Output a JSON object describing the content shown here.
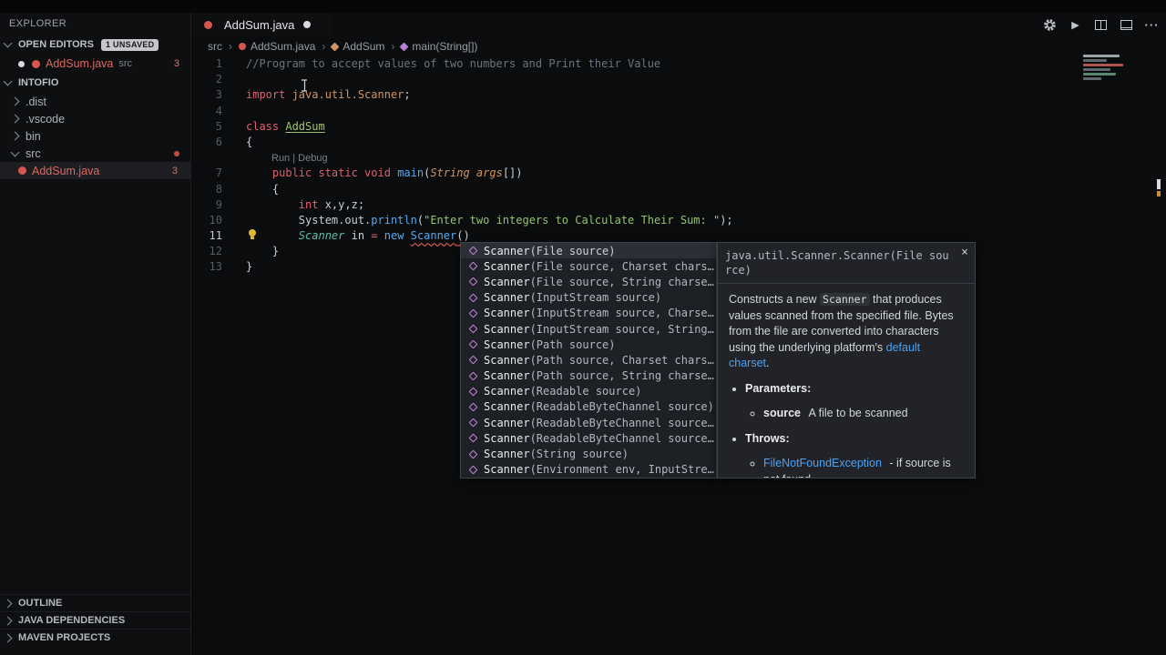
{
  "icons": {
    "close": "×",
    "run": "▶",
    "more": "···",
    "breadcrumb_separator": "›"
  },
  "window": {
    "tab": {
      "label": "AddSum.java"
    }
  },
  "sidebar": {
    "title": "EXPLORER",
    "open_editors": {
      "header": "OPEN EDITORS",
      "badge": "1 UNSAVED",
      "items": [
        {
          "label": "AddSum.java",
          "detail": "src",
          "problems": "3"
        }
      ]
    },
    "workspace": {
      "header": "INTOFIO",
      "tree": [
        {
          "label": ".dist",
          "type": "folder",
          "expanded": false
        },
        {
          "label": ".vscode",
          "type": "folder",
          "expanded": false
        },
        {
          "label": "bin",
          "type": "folder",
          "expanded": false
        },
        {
          "label": "src",
          "type": "folder",
          "expanded": true,
          "modified": true
        },
        {
          "label": "AddSum.java",
          "type": "file",
          "error": true,
          "problems": "3",
          "selected": true
        }
      ]
    },
    "sections": [
      {
        "label": "OUTLINE"
      },
      {
        "label": "JAVA DEPENDENCIES"
      },
      {
        "label": "MAVEN PROJECTS"
      }
    ]
  },
  "breadcrumb": {
    "items": [
      {
        "label": "src",
        "icon": "none"
      },
      {
        "label": "AddSum.java",
        "icon": "file"
      },
      {
        "label": "AddSum",
        "icon": "class"
      },
      {
        "label": "main(String[])",
        "icon": "method"
      }
    ]
  },
  "editor": {
    "codelens": "Run | Debug",
    "lines": [
      {
        "num": "1",
        "tokens": [
          {
            "c": "com",
            "t": "//Program to accept values of two numbers and Print their Value"
          }
        ]
      },
      {
        "num": "2",
        "tokens": []
      },
      {
        "num": "3",
        "tokens": [
          {
            "c": "kw",
            "t": "import "
          },
          {
            "c": "ns",
            "t": "java.util.Scanner"
          },
          {
            "c": "pln",
            "t": ";"
          }
        ]
      },
      {
        "num": "4",
        "tokens": []
      },
      {
        "num": "5",
        "tokens": [
          {
            "c": "kw",
            "t": "class "
          },
          {
            "c": "cls",
            "t": "AddSum"
          }
        ]
      },
      {
        "num": "6",
        "tokens": [
          {
            "c": "pln",
            "t": "{"
          }
        ]
      },
      {
        "num": "",
        "codelens": true
      },
      {
        "num": "7",
        "tokens": [
          {
            "c": "pln",
            "t": "    "
          },
          {
            "c": "kw",
            "t": "public static void "
          },
          {
            "c": "fn",
            "t": "main"
          },
          {
            "c": "pln",
            "t": "("
          },
          {
            "c": "typ",
            "t": "String args"
          },
          {
            "c": "pln",
            "t": "[])"
          }
        ]
      },
      {
        "num": "8",
        "tokens": [
          {
            "c": "pln",
            "t": "    {"
          }
        ]
      },
      {
        "num": "9",
        "tokens": [
          {
            "c": "pln",
            "t": "        "
          },
          {
            "c": "kw",
            "t": "int"
          },
          {
            "c": "pln",
            "t": " x,y,z;"
          }
        ]
      },
      {
        "num": "10",
        "tokens": [
          {
            "c": "pln",
            "t": "        System.out."
          },
          {
            "c": "fn",
            "t": "println"
          },
          {
            "c": "pln",
            "t": "("
          },
          {
            "c": "str",
            "t": "\"Enter two integers to Calculate Their Sum: \""
          },
          {
            "c": "pln",
            "t": ");"
          }
        ]
      },
      {
        "num": "11",
        "active": true,
        "lightbulb": true,
        "tokens": [
          {
            "c": "pln",
            "t": "        "
          },
          {
            "c": "sc",
            "t": "Scanner"
          },
          {
            "c": "pln",
            "t": " in "
          },
          {
            "c": "kw",
            "t": "="
          },
          {
            "c": "pln",
            "t": " "
          },
          {
            "c": "new",
            "t": "new"
          },
          {
            "c": "pln",
            "t": " "
          },
          {
            "c": "errfn",
            "t": "Scanner"
          },
          {
            "c": "errp",
            "t": "()"
          }
        ]
      },
      {
        "num": "12",
        "tokens": [
          {
            "c": "pln",
            "t": "    }"
          }
        ]
      },
      {
        "num": "13",
        "tokens": [
          {
            "c": "pln",
            "t": "}"
          }
        ]
      }
    ]
  },
  "suggest": {
    "selected": 0,
    "items": [
      {
        "label": "Scanner(File source)"
      },
      {
        "label": "Scanner(File source, Charset chars…"
      },
      {
        "label": "Scanner(File source, String charse…"
      },
      {
        "label": "Scanner(InputStream source)"
      },
      {
        "label": "Scanner(InputStream source, Charse…"
      },
      {
        "label": "Scanner(InputStream source, String…"
      },
      {
        "label": "Scanner(Path source)"
      },
      {
        "label": "Scanner(Path source, Charset chars…"
      },
      {
        "label": "Scanner(Path source, String charse…"
      },
      {
        "label": "Scanner(Readable source)"
      },
      {
        "label": "Scanner(ReadableByteChannel source)"
      },
      {
        "label": "Scanner(ReadableByteChannel source…"
      },
      {
        "label": "Scanner(ReadableByteChannel source…"
      },
      {
        "label": "Scanner(String source)"
      },
      {
        "label": "Scanner(Environment env, InputStre…"
      }
    ]
  },
  "docs": {
    "signature": "java.util.Scanner.Scanner(File source)",
    "description": [
      {
        "t": "Constructs a new "
      },
      {
        "t": "Scanner",
        "s": "code"
      },
      {
        "t": " that produces values scanned from the specified file. Bytes from the file are converted into characters using the underlying platform's "
      },
      {
        "t": "default charset",
        "s": "link"
      },
      {
        "t": "."
      }
    ],
    "parameters_label": "Parameters:",
    "parameter": {
      "name": "source",
      "description": "A file to be scanned"
    },
    "throws_label": "Throws:",
    "throws": {
      "link": "FileNotFoundException",
      "description": "- if source is not found"
    }
  }
}
